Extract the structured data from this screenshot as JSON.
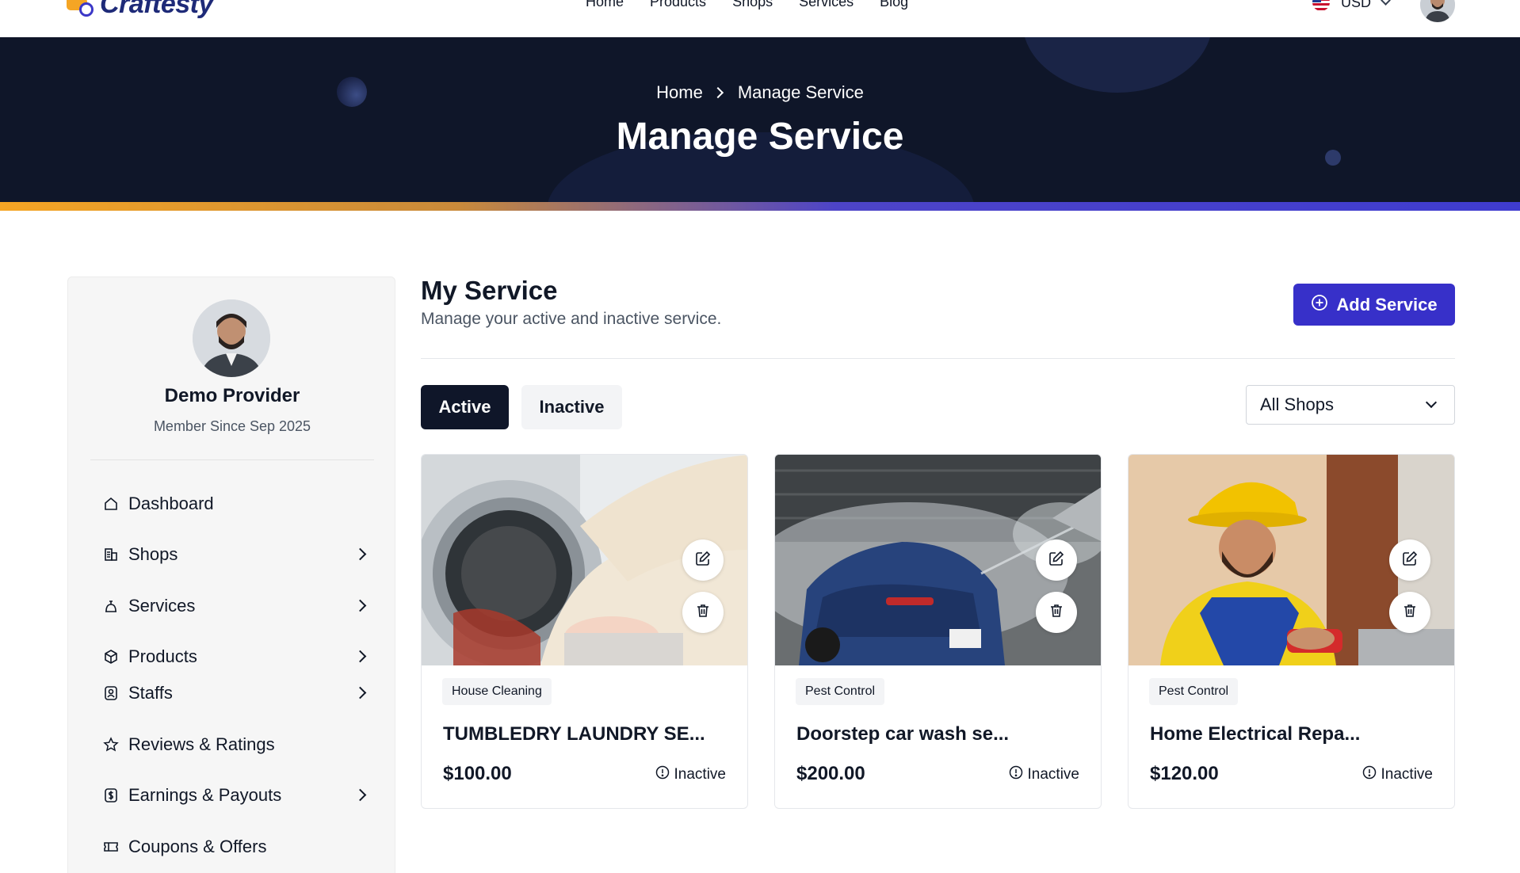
{
  "brand": {
    "name": "Craftesty"
  },
  "nav": {
    "links": [
      "Home",
      "Products",
      "Shops",
      "Services",
      "Blog"
    ],
    "currency": "USD"
  },
  "hero": {
    "breadcrumb": {
      "home": "Home",
      "current": "Manage Service"
    },
    "title": "Manage Service"
  },
  "sidebar": {
    "profile": {
      "name": "Demo Provider",
      "since": "Member Since Sep 2025"
    },
    "items": [
      {
        "label": "Dashboard",
        "icon": "home-icon",
        "has_children": false
      },
      {
        "label": "Shops",
        "icon": "shop-icon",
        "has_children": true
      },
      {
        "label": "Services",
        "icon": "services-icon",
        "has_children": true
      },
      {
        "label": "Products",
        "icon": "box-icon",
        "has_children": true
      },
      {
        "label": "Staffs",
        "icon": "staff-icon",
        "has_children": true
      },
      {
        "label": "Reviews & Ratings",
        "icon": "star-icon",
        "has_children": false
      },
      {
        "label": "Earnings & Payouts",
        "icon": "dollar-icon",
        "has_children": true
      },
      {
        "label": "Coupons & Offers",
        "icon": "ticket-icon",
        "has_children": false
      }
    ]
  },
  "main": {
    "title": "My Service",
    "subtitle": "Manage your active and inactive service.",
    "add_button": "Add Service",
    "tabs": {
      "active": "Active",
      "inactive": "Inactive"
    },
    "shop_filter": "All Shops",
    "cards": [
      {
        "category": "House Cleaning",
        "title": "TUMBLEDRY LAUNDRY SE...",
        "price": "$100.00",
        "status": "Inactive"
      },
      {
        "category": "Pest Control",
        "title": "Doorstep car wash se...",
        "price": "$200.00",
        "status": "Inactive"
      },
      {
        "category": "Pest Control",
        "title": "Home Electrical Repa...",
        "price": "$120.00",
        "status": "Inactive"
      }
    ]
  },
  "colors": {
    "primary": "#3730c9",
    "hero_bg": "#0f1629",
    "accent_orange": "#f5a524"
  }
}
